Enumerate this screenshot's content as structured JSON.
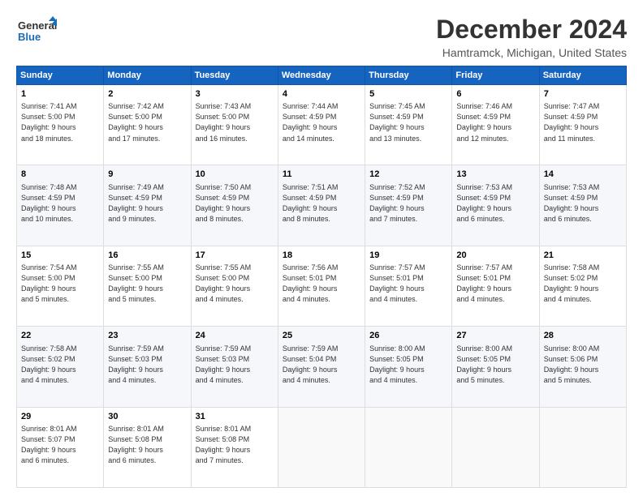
{
  "header": {
    "logo_line1": "General",
    "logo_line2": "Blue",
    "title": "December 2024",
    "subtitle": "Hamtramck, Michigan, United States"
  },
  "days_of_week": [
    "Sunday",
    "Monday",
    "Tuesday",
    "Wednesday",
    "Thursday",
    "Friday",
    "Saturday"
  ],
  "weeks": [
    [
      {
        "day": "1",
        "info": "Sunrise: 7:41 AM\nSunset: 5:00 PM\nDaylight: 9 hours\nand 18 minutes."
      },
      {
        "day": "2",
        "info": "Sunrise: 7:42 AM\nSunset: 5:00 PM\nDaylight: 9 hours\nand 17 minutes."
      },
      {
        "day": "3",
        "info": "Sunrise: 7:43 AM\nSunset: 5:00 PM\nDaylight: 9 hours\nand 16 minutes."
      },
      {
        "day": "4",
        "info": "Sunrise: 7:44 AM\nSunset: 4:59 PM\nDaylight: 9 hours\nand 14 minutes."
      },
      {
        "day": "5",
        "info": "Sunrise: 7:45 AM\nSunset: 4:59 PM\nDaylight: 9 hours\nand 13 minutes."
      },
      {
        "day": "6",
        "info": "Sunrise: 7:46 AM\nSunset: 4:59 PM\nDaylight: 9 hours\nand 12 minutes."
      },
      {
        "day": "7",
        "info": "Sunrise: 7:47 AM\nSunset: 4:59 PM\nDaylight: 9 hours\nand 11 minutes."
      }
    ],
    [
      {
        "day": "8",
        "info": "Sunrise: 7:48 AM\nSunset: 4:59 PM\nDaylight: 9 hours\nand 10 minutes."
      },
      {
        "day": "9",
        "info": "Sunrise: 7:49 AM\nSunset: 4:59 PM\nDaylight: 9 hours\nand 9 minutes."
      },
      {
        "day": "10",
        "info": "Sunrise: 7:50 AM\nSunset: 4:59 PM\nDaylight: 9 hours\nand 8 minutes."
      },
      {
        "day": "11",
        "info": "Sunrise: 7:51 AM\nSunset: 4:59 PM\nDaylight: 9 hours\nand 8 minutes."
      },
      {
        "day": "12",
        "info": "Sunrise: 7:52 AM\nSunset: 4:59 PM\nDaylight: 9 hours\nand 7 minutes."
      },
      {
        "day": "13",
        "info": "Sunrise: 7:53 AM\nSunset: 4:59 PM\nDaylight: 9 hours\nand 6 minutes."
      },
      {
        "day": "14",
        "info": "Sunrise: 7:53 AM\nSunset: 4:59 PM\nDaylight: 9 hours\nand 6 minutes."
      }
    ],
    [
      {
        "day": "15",
        "info": "Sunrise: 7:54 AM\nSunset: 5:00 PM\nDaylight: 9 hours\nand 5 minutes."
      },
      {
        "day": "16",
        "info": "Sunrise: 7:55 AM\nSunset: 5:00 PM\nDaylight: 9 hours\nand 5 minutes."
      },
      {
        "day": "17",
        "info": "Sunrise: 7:55 AM\nSunset: 5:00 PM\nDaylight: 9 hours\nand 4 minutes."
      },
      {
        "day": "18",
        "info": "Sunrise: 7:56 AM\nSunset: 5:01 PM\nDaylight: 9 hours\nand 4 minutes."
      },
      {
        "day": "19",
        "info": "Sunrise: 7:57 AM\nSunset: 5:01 PM\nDaylight: 9 hours\nand 4 minutes."
      },
      {
        "day": "20",
        "info": "Sunrise: 7:57 AM\nSunset: 5:01 PM\nDaylight: 9 hours\nand 4 minutes."
      },
      {
        "day": "21",
        "info": "Sunrise: 7:58 AM\nSunset: 5:02 PM\nDaylight: 9 hours\nand 4 minutes."
      }
    ],
    [
      {
        "day": "22",
        "info": "Sunrise: 7:58 AM\nSunset: 5:02 PM\nDaylight: 9 hours\nand 4 minutes."
      },
      {
        "day": "23",
        "info": "Sunrise: 7:59 AM\nSunset: 5:03 PM\nDaylight: 9 hours\nand 4 minutes."
      },
      {
        "day": "24",
        "info": "Sunrise: 7:59 AM\nSunset: 5:03 PM\nDaylight: 9 hours\nand 4 minutes."
      },
      {
        "day": "25",
        "info": "Sunrise: 7:59 AM\nSunset: 5:04 PM\nDaylight: 9 hours\nand 4 minutes."
      },
      {
        "day": "26",
        "info": "Sunrise: 8:00 AM\nSunset: 5:05 PM\nDaylight: 9 hours\nand 4 minutes."
      },
      {
        "day": "27",
        "info": "Sunrise: 8:00 AM\nSunset: 5:05 PM\nDaylight: 9 hours\nand 5 minutes."
      },
      {
        "day": "28",
        "info": "Sunrise: 8:00 AM\nSunset: 5:06 PM\nDaylight: 9 hours\nand 5 minutes."
      }
    ],
    [
      {
        "day": "29",
        "info": "Sunrise: 8:01 AM\nSunset: 5:07 PM\nDaylight: 9 hours\nand 6 minutes."
      },
      {
        "day": "30",
        "info": "Sunrise: 8:01 AM\nSunset: 5:08 PM\nDaylight: 9 hours\nand 6 minutes."
      },
      {
        "day": "31",
        "info": "Sunrise: 8:01 AM\nSunset: 5:08 PM\nDaylight: 9 hours\nand 7 minutes."
      },
      {
        "day": "",
        "info": ""
      },
      {
        "day": "",
        "info": ""
      },
      {
        "day": "",
        "info": ""
      },
      {
        "day": "",
        "info": ""
      }
    ]
  ]
}
